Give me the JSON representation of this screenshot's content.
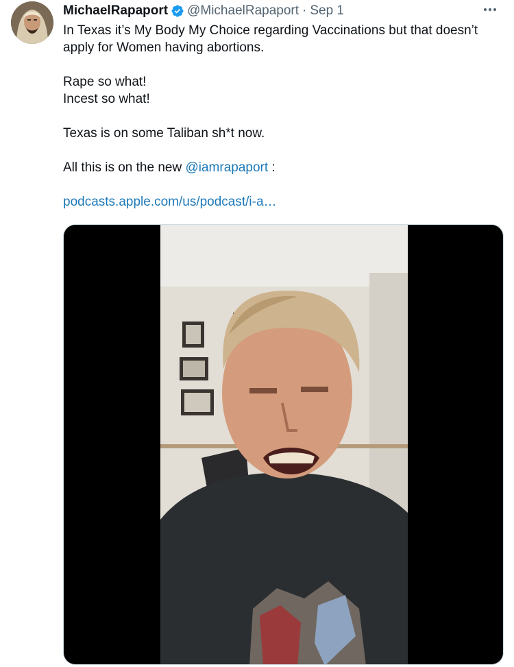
{
  "author": {
    "display_name": "MichaelRapaport",
    "handle": "@MichaelRapaport",
    "separator": "·",
    "date": "Sep 1"
  },
  "icons": {
    "verified": "verified-badge-icon",
    "more": "more-options-icon"
  },
  "colors": {
    "link": "#1d79b8",
    "verified": "#1d9bf0",
    "secondary_text": "#536471"
  },
  "tweet": {
    "line1": "In Texas it’s My Body My Choice regarding Vaccinations but that doesn’t",
    "line2": "apply for Women having abortions.",
    "line3": "Rape so what!",
    "line4": "Incest so what!",
    "line5": "Texas is on some Taliban sh*t now.",
    "line6_prefix": "All this is on the new ",
    "mention": "@iamrapaport",
    "line6_suffix": " :",
    "link": "podcasts.apple.com/us/podcast/i-a…"
  }
}
